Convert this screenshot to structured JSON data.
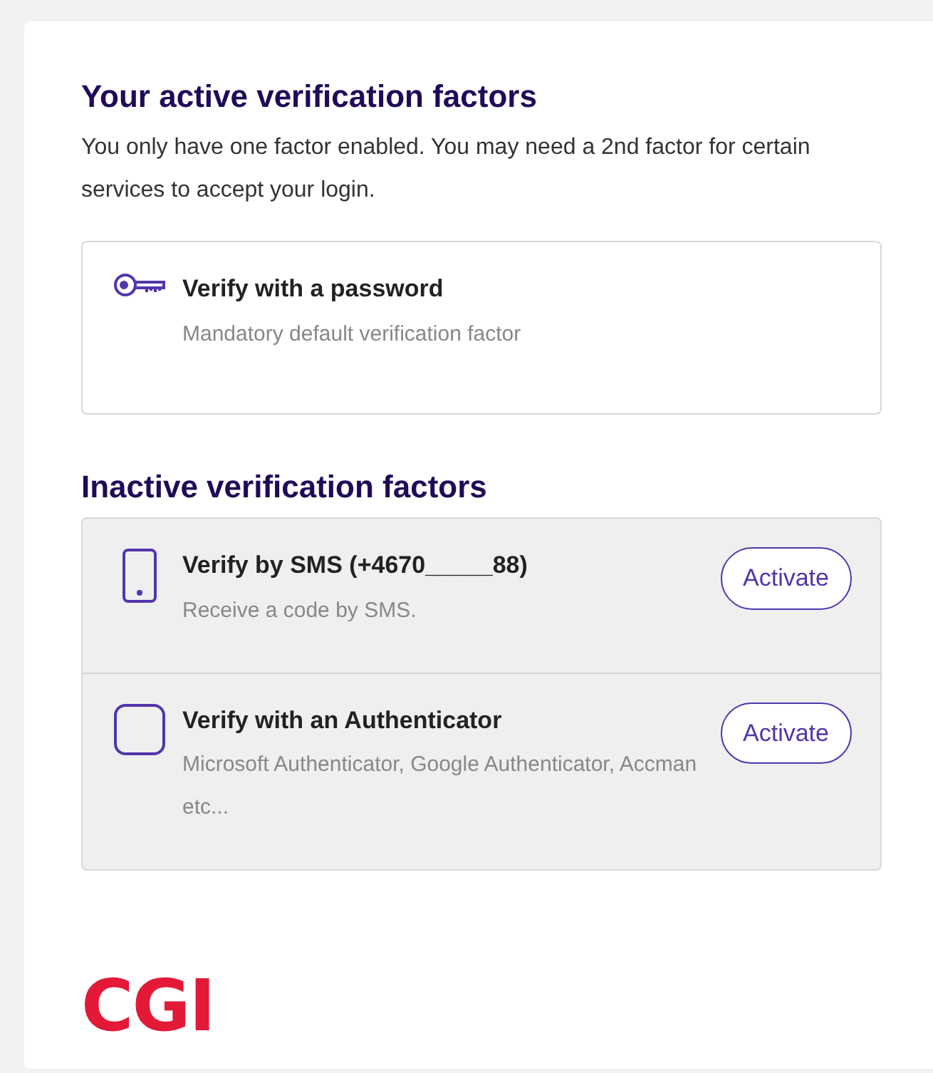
{
  "active_section": {
    "title": "Your active verification factors",
    "description": "You only have one factor enabled. You may need a 2nd factor for certain services to accept your login.",
    "factors": [
      {
        "kind": "key",
        "title": "Verify with a password",
        "subtitle": "Mandatory default verification factor"
      }
    ]
  },
  "inactive_section": {
    "title": "Inactive verification factors",
    "factors": [
      {
        "kind": "phone",
        "title": "Verify by SMS (+4670_____88)",
        "subtitle": "Receive a code by SMS.",
        "button": "Activate"
      },
      {
        "kind": "authenticator",
        "title": "Verify with an Authenticator",
        "subtitle": "Microsoft Authenticator, Google Authenticator, Accman etc...",
        "button": "Activate"
      }
    ]
  },
  "logo": "CGI"
}
